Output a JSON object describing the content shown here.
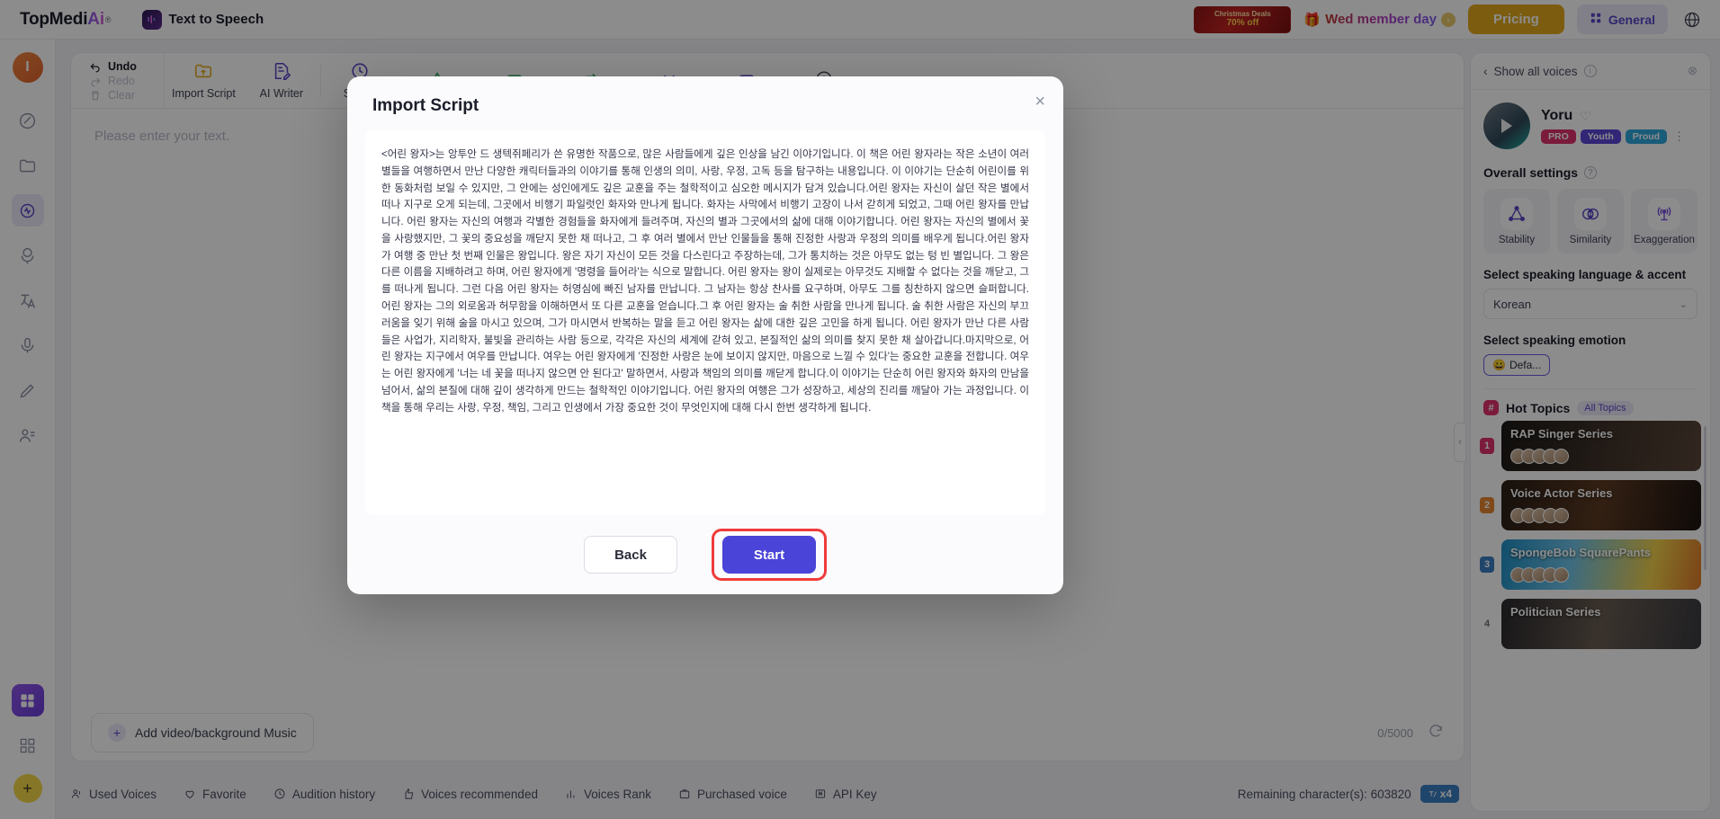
{
  "topbar": {
    "brand_prefix": "TopMedi",
    "brand_ai": "Ai",
    "brand_reg": "®",
    "app_name": "Text to Speech",
    "xmas_line1": "Christmas Deals",
    "xmas_line2": "70% off",
    "member_day": "Wed member day",
    "pricing": "Pricing",
    "general": "General"
  },
  "toolbar": {
    "undo": "Undo",
    "redo": "Redo",
    "clear": "Clear",
    "import_script": "Import Script",
    "ai_writer": "AI Writer",
    "speed": "Speed"
  },
  "editor": {
    "placeholder": "Please enter your text.",
    "add_music": "Add video/background Music",
    "char_count": "0/5000"
  },
  "bottombar": {
    "items": [
      {
        "label": "Used Voices",
        "icon": "used-voices-icon"
      },
      {
        "label": "Favorite",
        "icon": "heart-icon"
      },
      {
        "label": "Audition history",
        "icon": "history-icon"
      },
      {
        "label": "Voices recommended",
        "icon": "thumb-up-icon"
      },
      {
        "label": "Voices Rank",
        "icon": "bar-chart-icon"
      },
      {
        "label": "Purchased voice",
        "icon": "bag-icon"
      },
      {
        "label": "API Key",
        "icon": "api-key-icon"
      }
    ],
    "remaining": "Remaining character(s): 603820",
    "multiplier": "x4"
  },
  "rightpanel": {
    "show_all_voices": "Show all voices",
    "voice_name": "Yoru",
    "tags": [
      "PRO",
      "Youth",
      "Proud"
    ],
    "overall_settings": "Overall settings",
    "settings": [
      {
        "label": "Stability",
        "icon": "stability-icon"
      },
      {
        "label": "Similarity",
        "icon": "similarity-icon"
      },
      {
        "label": "Exaggeration",
        "icon": "exaggeration-icon"
      }
    ],
    "language_label": "Select speaking language & accent",
    "language_value": "Korean",
    "emotion_label": "Select speaking emotion",
    "emotion_value": "Defa...",
    "hot_topics_title": "Hot Topics",
    "all_topics": "All Topics",
    "hot_items": [
      {
        "rank": "1",
        "title": "RAP Singer Series"
      },
      {
        "rank": "2",
        "title": "Voice Actor Series"
      },
      {
        "rank": "3",
        "title": "SpongeBob SquarePants"
      },
      {
        "rank": "4",
        "title": "Politician Series"
      }
    ]
  },
  "modal": {
    "title": "Import Script",
    "close": "×",
    "back": "Back",
    "start": "Start",
    "script": "<어린 왕자>는 앙투안 드 생텍쥐페리가 쓴 유명한 작품으로, 많은 사람들에게 깊은 인상을 남긴 이야기입니다. 이 책은 어린 왕자라는 작은 소년이 여러 별들을 여행하면서 만난 다양한 캐릭터들과의 이야기를 통해 인생의 의미, 사랑, 우정, 고독 등을 탐구하는 내용입니다. 이 이야기는 단순히 어린이를 위한 동화처럼 보일 수 있지만, 그 안에는 성인에게도 깊은 교훈을 주는 철학적이고 심오한 메시지가 담겨 있습니다.어린 왕자는 자신이 살던 작은 별에서 떠나 지구로 오게 되는데, 그곳에서 비행기 파일럿인 화자와 만나게 됩니다. 화자는 사막에서 비행기 고장이 나서 갇히게 되었고, 그때 어린 왕자를 만납니다. 어린 왕자는 자신의 여행과 각별한 경험들을 화자에게 들려주며, 자신의 별과 그곳에서의 삶에 대해 이야기합니다. 어린 왕자는 자신의 별에서 꽃을 사랑했지만, 그 꽃의 중요성을 깨닫지 못한 채 떠나고, 그 후 여러 별에서 만난 인물들을 통해 진정한 사랑과 우정의 의미를 배우게 됩니다.어린 왕자가 여행 중 만난 첫 번째 인물은 왕입니다. 왕은 자기 자신이 모든 것을 다스린다고 주장하는데, 그가 통치하는 것은 아무도 없는 텅 빈 별입니다. 그 왕은 다른 이름을 지배하려고 하며, 어린 왕자에게 '명령을 들어라'는 식으로 말합니다. 어린 왕자는 왕이 실제로는 아무것도 지배할 수 없다는 것을 깨닫고, 그를 떠나게 됩니다. 그런 다음 어린 왕자는 허영심에 빠진 남자를 만납니다. 그 남자는 항상 찬사를 요구하며, 아무도 그를 칭찬하지 않으면 슬퍼합니다. 어린 왕자는 그의 외로움과 허무함을 이해하면서 또 다른 교훈을 얻습니다.그 후 어린 왕자는 술 취한 사람을 만나게 됩니다. 술 취한 사람은 자신의 부끄러움을 잊기 위해 술을 마시고 있으며, 그가 마시면서 반복하는 말을 듣고 어린 왕자는 삶에 대한 깊은 고민을 하게 됩니다. 어린 왕자가 만난 다른 사람들은 사업가, 지리학자, 불빛을 관리하는 사람 등으로, 각각은 자신의 세계에 갇혀 있고, 본질적인 삶의 의미를 찾지 못한 채 살아갑니다.마지막으로, 어린 왕자는 지구에서 여우를 만납니다. 여우는 어린 왕자에게 '진정한 사랑은 눈에 보이지 않지만, 마음으로 느낄 수 있다'는 중요한 교훈을 전합니다. 여우는 어린 왕자에게 '너는 네 꽃을 떠나지 않으면 안 된다고' 말하면서, 사랑과 책임의 의미를 깨닫게 합니다.이 이야기는 단순히 어린 왕자와 화자의 만남을 넘어서, 삶의 본질에 대해 깊이 생각하게 만드는 철학적인 이야기입니다. 어린 왕자의 여행은 그가 성장하고, 세상의 진리를 깨달아 가는 과정입니다. 이 책을 통해 우리는 사랑, 우정, 책임, 그리고 인생에서 가장 중요한 것이 무엇인지에 대해 다시 한번 생각하게 됩니다."
  }
}
